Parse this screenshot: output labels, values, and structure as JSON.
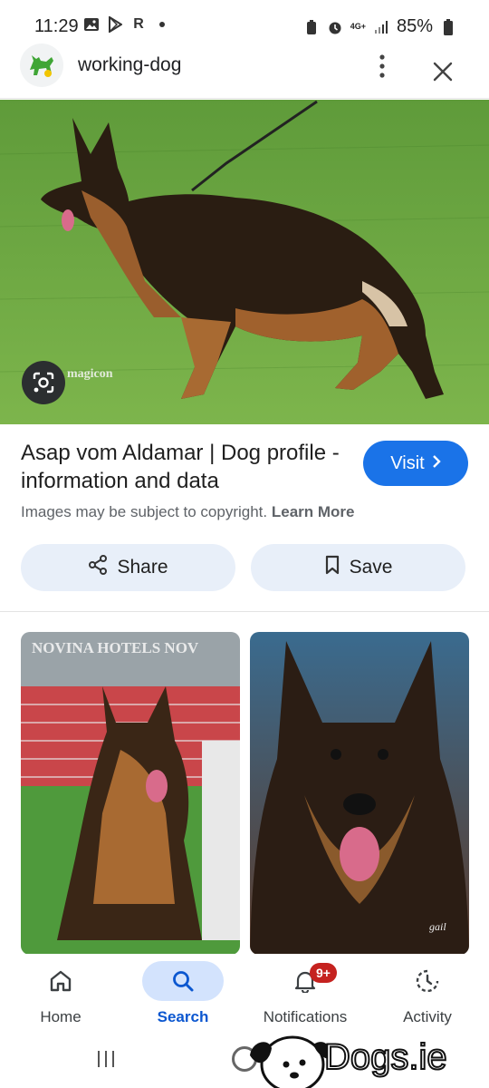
{
  "status_bar": {
    "time": "11:29",
    "left_icons": [
      "image-icon",
      "play-store-icon",
      "r-icon",
      "dot-icon"
    ],
    "r_letter": "R",
    "network_label": "4G+",
    "battery_percent": "85%"
  },
  "header": {
    "site_name": "working-dog",
    "logo_icon": "dog-logo-icon",
    "brand_color": "#3fa535"
  },
  "result": {
    "title": "Asap vom Aldamar | Dog profile - information and data",
    "visit_label": "Visit",
    "copyright_text": "Images may be subject to copyright.",
    "learn_more_label": "Learn More",
    "image_watermark": "magicon"
  },
  "actions": {
    "share_label": "Share",
    "save_label": "Save"
  },
  "thumbnails": [
    {
      "alt_icon": "dog-photo-icon",
      "banner_text": "NOVINA HOTELS    NOV"
    },
    {
      "alt_icon": "dog-photo-icon",
      "signature": "gail"
    }
  ],
  "bottom_nav": {
    "items": [
      {
        "label": "Home",
        "icon": "home-icon"
      },
      {
        "label": "Search",
        "icon": "search-icon",
        "active": true
      },
      {
        "label": "Notifications",
        "icon": "bell-icon",
        "badge": "9+"
      },
      {
        "label": "Activity",
        "icon": "activity-icon"
      }
    ]
  },
  "colors": {
    "accent": "#1a73e8",
    "pill_background": "#e8eff9",
    "active_nav": "#d3e3fd",
    "badge": "#c5221f"
  },
  "overlay": {
    "brand_text": "Dogs.ie"
  }
}
